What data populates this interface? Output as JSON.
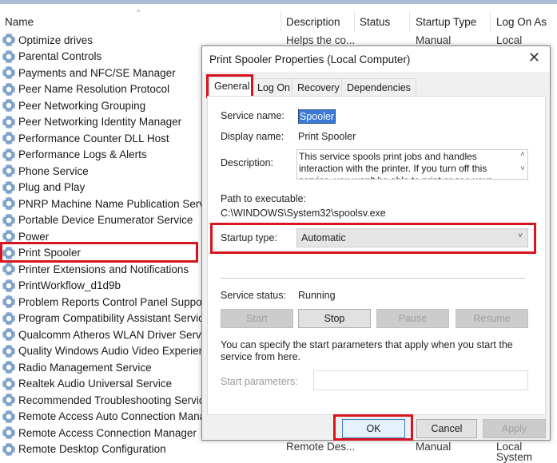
{
  "columns": [
    "Name",
    "Description",
    "Status",
    "Startup Type",
    "Log On As"
  ],
  "first_row": {
    "description": "Helps the co...",
    "startup": "Manual",
    "logon": "Local System"
  },
  "last_row": {
    "description": "Remote Des...",
    "startup": "Manual",
    "logon": "Local System"
  },
  "services": [
    "Optimize drives",
    "Parental Controls",
    "Payments and NFC/SE Manager",
    "Peer Name Resolution Protocol",
    "Peer Networking Grouping",
    "Peer Networking Identity Manager",
    "Performance Counter DLL Host",
    "Performance Logs & Alerts",
    "Phone Service",
    "Plug and Play",
    "PNRP Machine Name Publication Service",
    "Portable Device Enumerator Service",
    "Power",
    "Print Spooler",
    "Printer Extensions and Notifications",
    "PrintWorkflow_d1d9b",
    "Problem Reports Control Panel Support",
    "Program Compatibility Assistant Service",
    "Qualcomm Atheros WLAN Driver Service",
    "Quality Windows Audio Video Experience",
    "Radio Management Service",
    "Realtek Audio Universal Service",
    "Recommended Troubleshooting Service",
    "Remote Access Auto Connection Manager",
    "Remote Access Connection Manager",
    "Remote Desktop Configuration"
  ],
  "dialog": {
    "title": "Print Spooler Properties (Local Computer)",
    "tabs": [
      "General",
      "Log On",
      "Recovery",
      "Dependencies"
    ],
    "service_name_label": "Service name:",
    "service_name": "Spooler",
    "display_name_label": "Display name:",
    "display_name": "Print Spooler",
    "description_label": "Description:",
    "description": "This service spools print jobs and handles interaction with the printer.  If you turn off this service, you won't be able to print or see your printers.",
    "path_label": "Path to executable:",
    "path": "C:\\WINDOWS\\System32\\spoolsv.exe",
    "startup_label": "Startup type:",
    "startup_value": "Automatic",
    "status_label": "Service status:",
    "status": "Running",
    "start": "Start",
    "stop": "Stop",
    "pause": "Pause",
    "resume": "Resume",
    "hint": "You can specify the start parameters that apply when you start the service from here.",
    "params_label": "Start parameters:",
    "ok": "OK",
    "cancel": "Cancel",
    "apply": "Apply"
  },
  "highlight_color": "#d7141f"
}
